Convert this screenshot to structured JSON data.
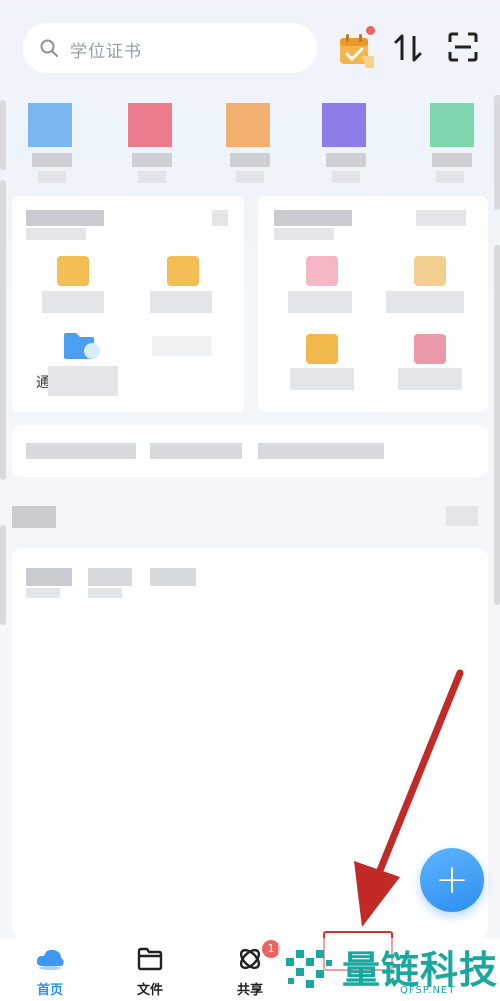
{
  "search": {
    "placeholder": "学位证书"
  },
  "header_icons": [
    "calendar-icon",
    "sort-icon",
    "scan-icon"
  ],
  "tabs": [
    {
      "label": "首页",
      "icon": "cloud-icon",
      "active": true
    },
    {
      "label": "文件",
      "icon": "folder-icon",
      "active": false
    },
    {
      "label": "共享",
      "icon": "share-icon",
      "active": false,
      "badge": "1"
    }
  ],
  "shortcut_partial_label": "通",
  "fab": {
    "label": "+"
  },
  "watermark": {
    "title": "量链科技",
    "domain": "QFSP.NET"
  },
  "colors": {
    "accent": "#2d8ff0",
    "badge": "#f06262",
    "arrow": "#c12a27",
    "watermark": "#1aa7a0"
  }
}
